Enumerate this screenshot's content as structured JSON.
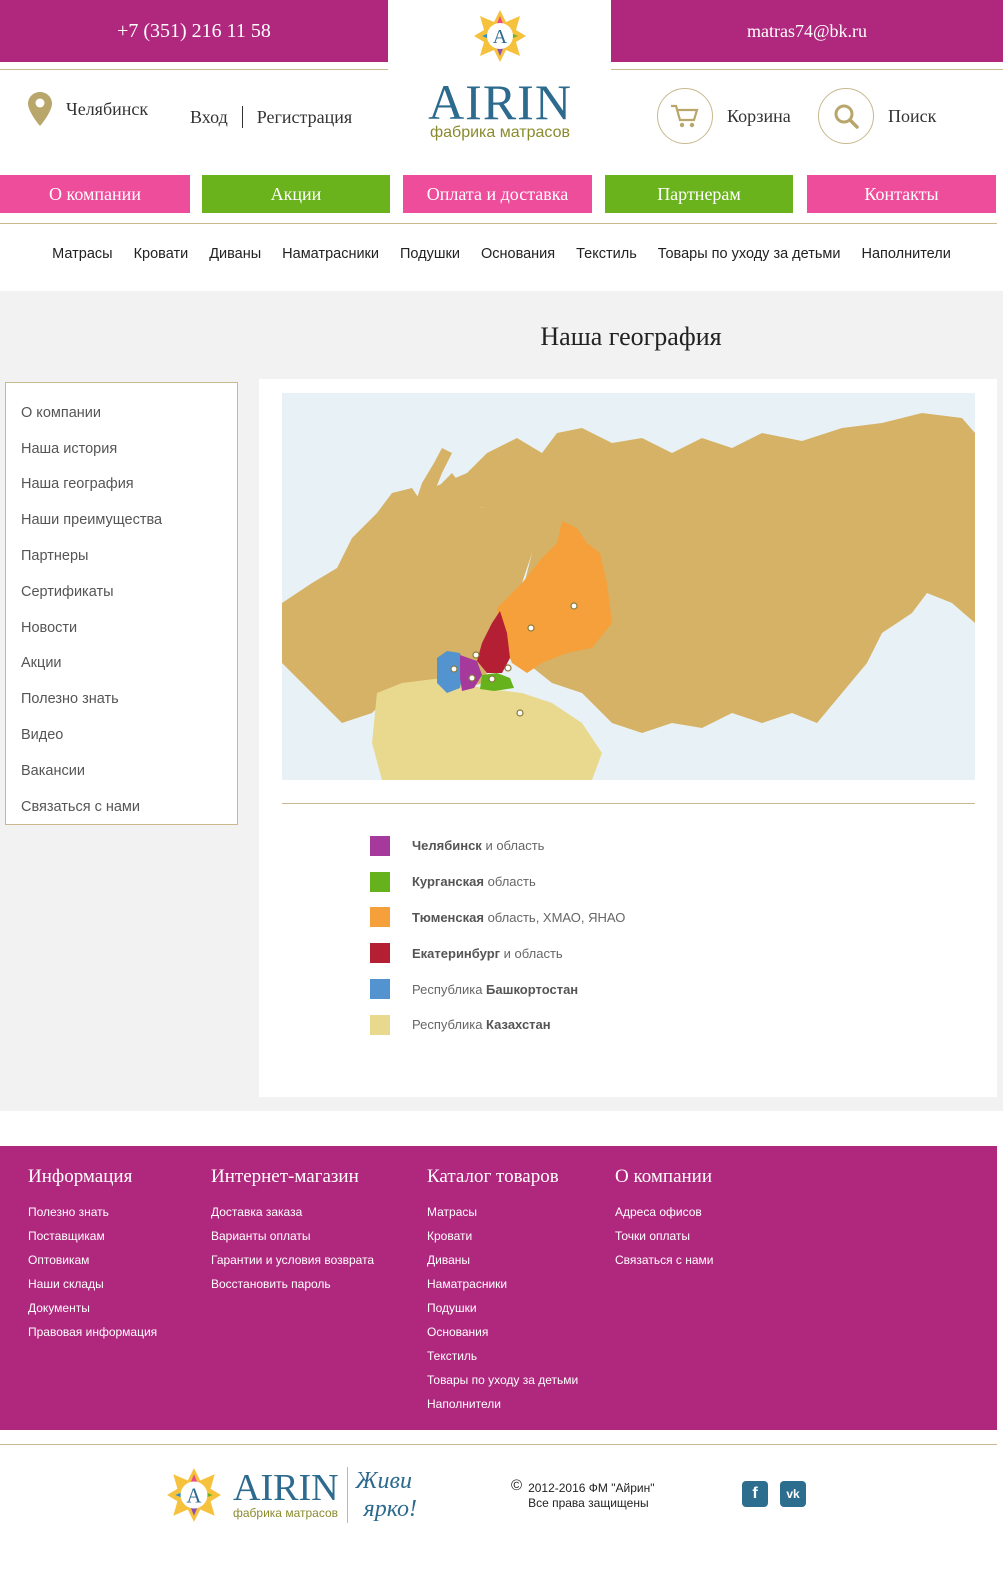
{
  "header": {
    "phone": "+7 (351) 216 11 58",
    "email": "matras74@bk.ru",
    "city": "Челябинск",
    "login": "Вход",
    "register": "Регистрация",
    "cart": "Корзина",
    "search": "Поиск",
    "logo_brand": "AIRIN",
    "logo_letter": "A",
    "logo_tagline": "фабрика матрасов"
  },
  "colors": {
    "magenta": "#b0287e",
    "pink": "#ee4d9b",
    "green": "#6ab31d",
    "gold": "#c8b98e",
    "blue": "#2c6a8e"
  },
  "main_nav": [
    {
      "label": "О компании",
      "color": "#ee4d9b"
    },
    {
      "label": "Акции",
      "color": "#6ab31d"
    },
    {
      "label": "Оплата и доставка",
      "color": "#ee4d9b"
    },
    {
      "label": "Партнерам",
      "color": "#6ab31d"
    },
    {
      "label": "Контакты",
      "color": "#ee4d9b"
    }
  ],
  "category_nav": [
    "Матрасы",
    "Кровати",
    "Диваны",
    "Наматрасники",
    "Подушки",
    "Основания",
    "Текстиль",
    "Товары по уходу за детьми",
    "Наполнители"
  ],
  "page_title": "Наша география",
  "side_menu": [
    "О компании",
    "Наша история",
    "Наша география",
    "Наши преимущества",
    "Партнеры",
    "Сертификаты",
    "Новости",
    "Акции",
    "Полезно знать",
    "Видео",
    "Вакансии",
    "Связаться с нами"
  ],
  "legend": [
    {
      "color": "#a63a9c",
      "bold": "Челябинск",
      "rest": " и область",
      "bold_first": true
    },
    {
      "color": "#66b21c",
      "bold": "Курганская",
      "rest": " область",
      "bold_first": true
    },
    {
      "color": "#f5a03a",
      "bold": "Тюменская",
      "rest": " область, ХМАО, ЯНАО",
      "bold_first": true
    },
    {
      "color": "#b51f34",
      "bold": "Екатеринбург",
      "rest": " и область",
      "bold_first": true
    },
    {
      "color": "#5393cf",
      "bold": "Башкортостан",
      "rest": "Республика ",
      "bold_first": false
    },
    {
      "color": "#e8d98e",
      "bold": "Казахстан",
      "rest": "Республика ",
      "bold_first": false
    }
  ],
  "footer": {
    "columns": [
      {
        "title": "Информация",
        "links": [
          "Полезно знать",
          "Поставщикам",
          "Оптовикам",
          "Наши склады",
          "Документы",
          "Правовая информация"
        ]
      },
      {
        "title": "Интернет-магазин",
        "links": [
          "Доставка заказа",
          "Варианты оплаты",
          "Гарантии и условия возврата",
          "Восстановить пароль"
        ]
      },
      {
        "title": "Каталог товаров",
        "links": [
          "Матрасы",
          "Кровати",
          "Диваны",
          "Наматрасники",
          "Подушки",
          "Основания",
          "Текстиль",
          "Товары по уходу за детьми",
          "Наполнители"
        ]
      },
      {
        "title": "О компании",
        "links": [
          "Адреса офисов",
          "Точки оплаты",
          "Связаться с нами"
        ]
      }
    ],
    "slogan_line1": "Живи",
    "slogan_line2": "ярко!",
    "copyright_symbol": "©",
    "copyright_line1": "2012-2016 ФМ \"Айрин\"",
    "copyright_line2": "Все права защищены",
    "social": [
      {
        "icon": "facebook-icon",
        "glyph": "f"
      },
      {
        "icon": "vk-icon",
        "glyph": "vk"
      }
    ]
  }
}
